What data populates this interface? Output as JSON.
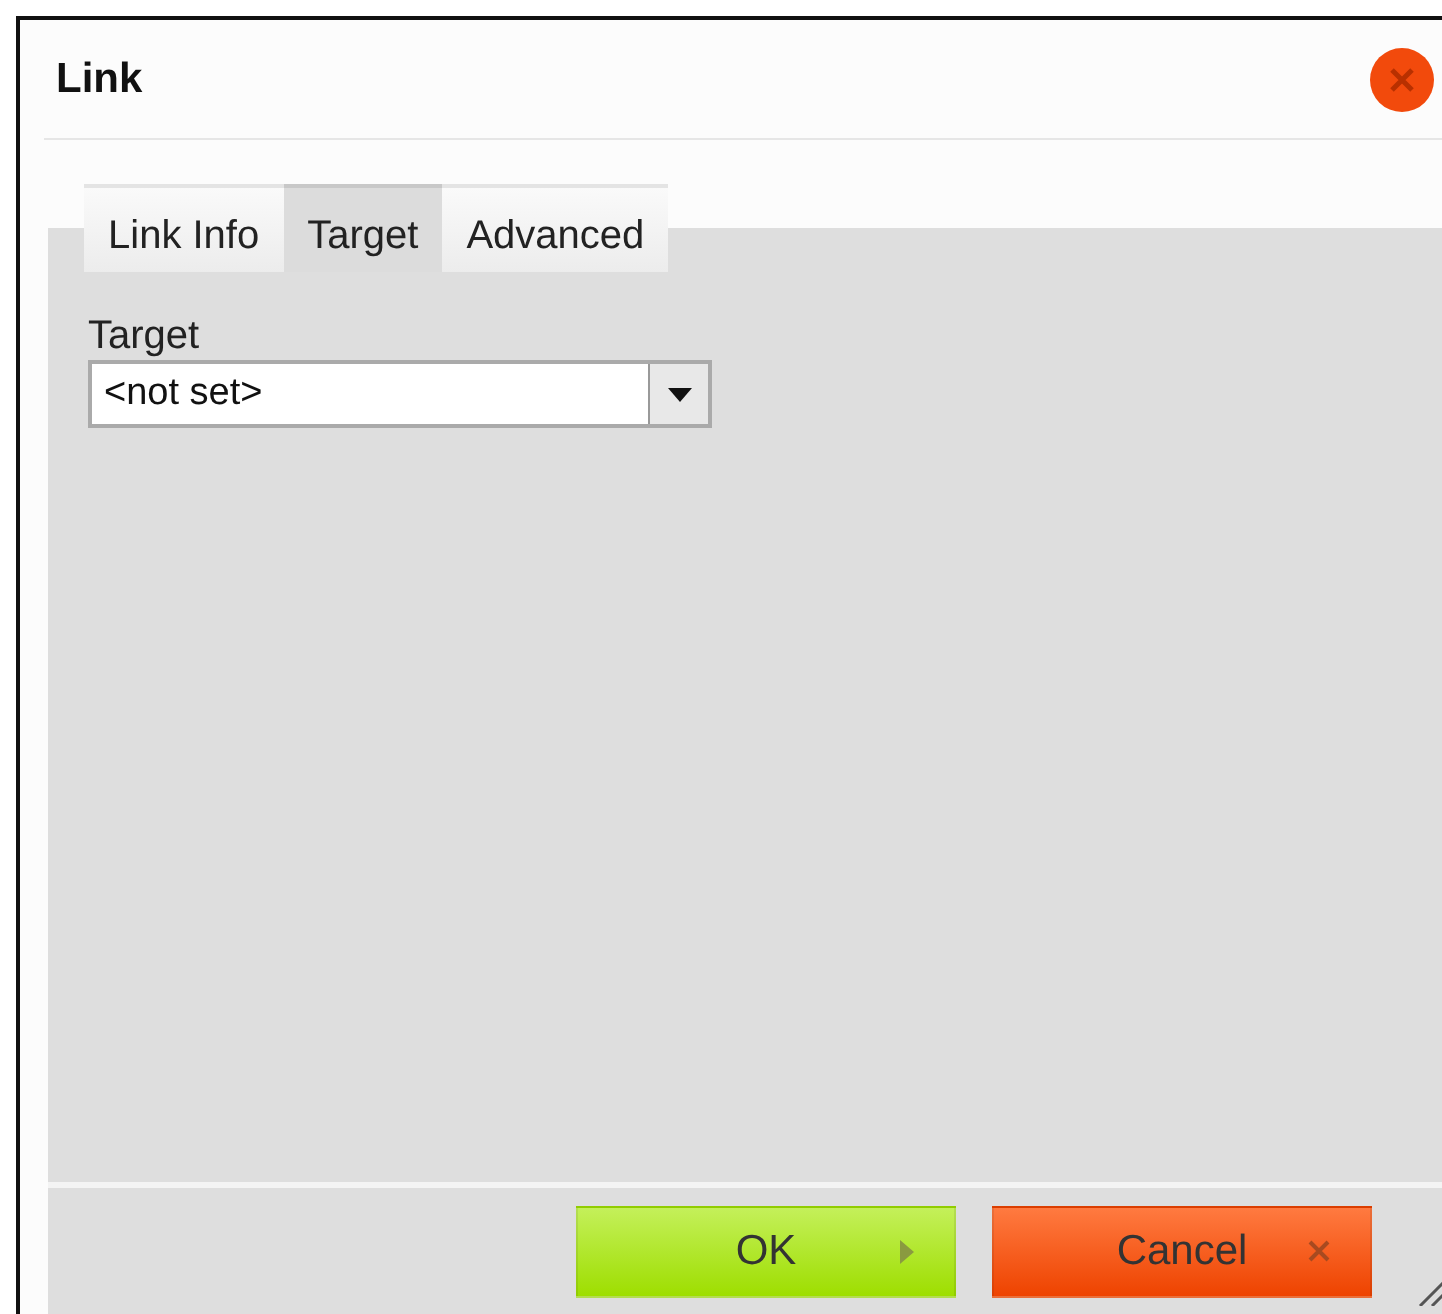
{
  "dialog": {
    "title": "Link"
  },
  "tabs": [
    {
      "label": "Link Info",
      "selected": false
    },
    {
      "label": "Target",
      "selected": true
    },
    {
      "label": "Advanced",
      "selected": false
    }
  ],
  "target_field": {
    "label": "Target",
    "value": "<not set>"
  },
  "buttons": [
    {
      "kind": "ok",
      "label": "OK"
    },
    {
      "kind": "cancel",
      "label": "Cancel"
    }
  ]
}
